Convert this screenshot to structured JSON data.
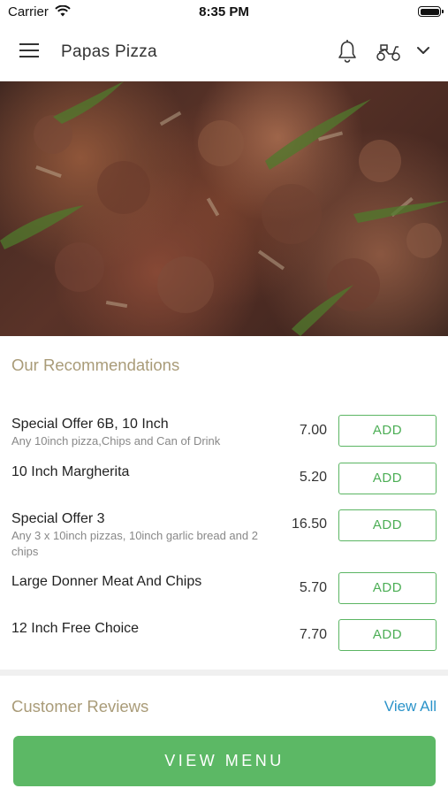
{
  "status_bar": {
    "carrier": "Carrier",
    "time": "8:35 PM"
  },
  "header": {
    "title": "Papas Pizza",
    "icons": [
      "menu-icon",
      "bell-icon",
      "scooter-icon",
      "chevron-down-icon"
    ]
  },
  "recommendations": {
    "title": "Our Recommendations",
    "items": [
      {
        "name": "Special Offer 6B, 10 Inch",
        "description": "Any 10inch pizza,Chips and Can of Drink",
        "price": "7.00",
        "button": "ADD"
      },
      {
        "name": "10 Inch Margherita",
        "description": "",
        "price": "5.20",
        "button": "ADD"
      },
      {
        "name": "Special Offer 3",
        "description": "Any 3 x 10inch pizzas, 10inch garlic bread and 2 chips",
        "price": "16.50",
        "button": "ADD"
      },
      {
        "name": "Large Donner Meat And Chips",
        "description": "",
        "price": "5.70",
        "button": "ADD"
      },
      {
        "name": "12 Inch Free Choice",
        "description": "",
        "price": "7.70",
        "button": "ADD"
      }
    ]
  },
  "reviews": {
    "title": "Customer Reviews",
    "view_all": "View All"
  },
  "cta": {
    "label": "VIEW MENU"
  },
  "colors": {
    "accent_green": "#5cb865",
    "section_title": "#a99b78",
    "link_blue": "#2b93c9"
  }
}
